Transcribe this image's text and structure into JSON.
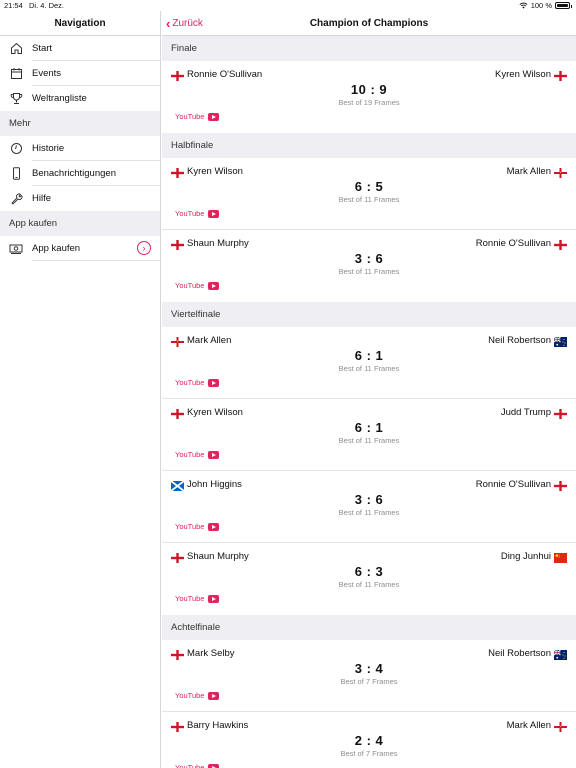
{
  "status": {
    "time": "21:54",
    "date": "Di. 4. Dez.",
    "battery": "100 %"
  },
  "sidebar": {
    "title": "Navigation",
    "items": [
      {
        "label": "Start",
        "icon": "home-icon"
      },
      {
        "label": "Events",
        "icon": "calendar-icon"
      },
      {
        "label": "Weltrangliste",
        "icon": "trophy-icon"
      }
    ],
    "section_more": "Mehr",
    "more_items": [
      {
        "label": "Historie",
        "icon": "history-icon"
      },
      {
        "label": "Benachrichtigungen",
        "icon": "phone-icon"
      },
      {
        "label": "Hilfe",
        "icon": "wrench-icon"
      }
    ],
    "section_buy": "App kaufen",
    "buy_item": {
      "label": "App kaufen",
      "icon": "cash-icon"
    }
  },
  "header": {
    "back_label": "Zurück",
    "title": "Champion of Champions"
  },
  "youtube_label": "YouTube",
  "rounds": [
    {
      "name": "Finale",
      "matches": [
        {
          "p1": "Ronnie O'Sullivan",
          "p1flag": "england",
          "p2": "Kyren Wilson",
          "p2flag": "england",
          "score": "10 : 9",
          "bestof": "Best of 19 Frames"
        }
      ]
    },
    {
      "name": "Halbfinale",
      "matches": [
        {
          "p1": "Kyren Wilson",
          "p1flag": "england",
          "p2": "Mark Allen",
          "p2flag": "northern-ireland",
          "score": "6 : 5",
          "bestof": "Best of 11 Frames"
        },
        {
          "p1": "Shaun Murphy",
          "p1flag": "england",
          "p2": "Ronnie O'Sullivan",
          "p2flag": "england",
          "score": "3 : 6",
          "bestof": "Best of 11 Frames"
        }
      ]
    },
    {
      "name": "Viertelfinale",
      "matches": [
        {
          "p1": "Mark Allen",
          "p1flag": "northern-ireland",
          "p2": "Neil Robertson",
          "p2flag": "australia",
          "score": "6 : 1",
          "bestof": "Best of 11 Frames"
        },
        {
          "p1": "Kyren Wilson",
          "p1flag": "england",
          "p2": "Judd Trump",
          "p2flag": "england",
          "score": "6 : 1",
          "bestof": "Best of 11 Frames"
        },
        {
          "p1": "John Higgins",
          "p1flag": "scotland",
          "p2": "Ronnie O'Sullivan",
          "p2flag": "england",
          "score": "3 : 6",
          "bestof": "Best of 11 Frames"
        },
        {
          "p1": "Shaun Murphy",
          "p1flag": "england",
          "p2": "Ding Junhui",
          "p2flag": "china",
          "score": "6 : 3",
          "bestof": "Best of 11 Frames"
        }
      ]
    },
    {
      "name": "Achtelfinale",
      "matches": [
        {
          "p1": "Mark Selby",
          "p1flag": "england",
          "p2": "Neil Robertson",
          "p2flag": "australia",
          "score": "3 : 4",
          "bestof": "Best of 7 Frames"
        },
        {
          "p1": "Barry Hawkins",
          "p1flag": "england",
          "p2": "Mark Allen",
          "p2flag": "northern-ireland",
          "score": "2 : 4",
          "bestof": "Best of 7 Frames"
        }
      ]
    }
  ],
  "colors": {
    "accent": "#e0245e",
    "section_bg": "#efeff3"
  }
}
